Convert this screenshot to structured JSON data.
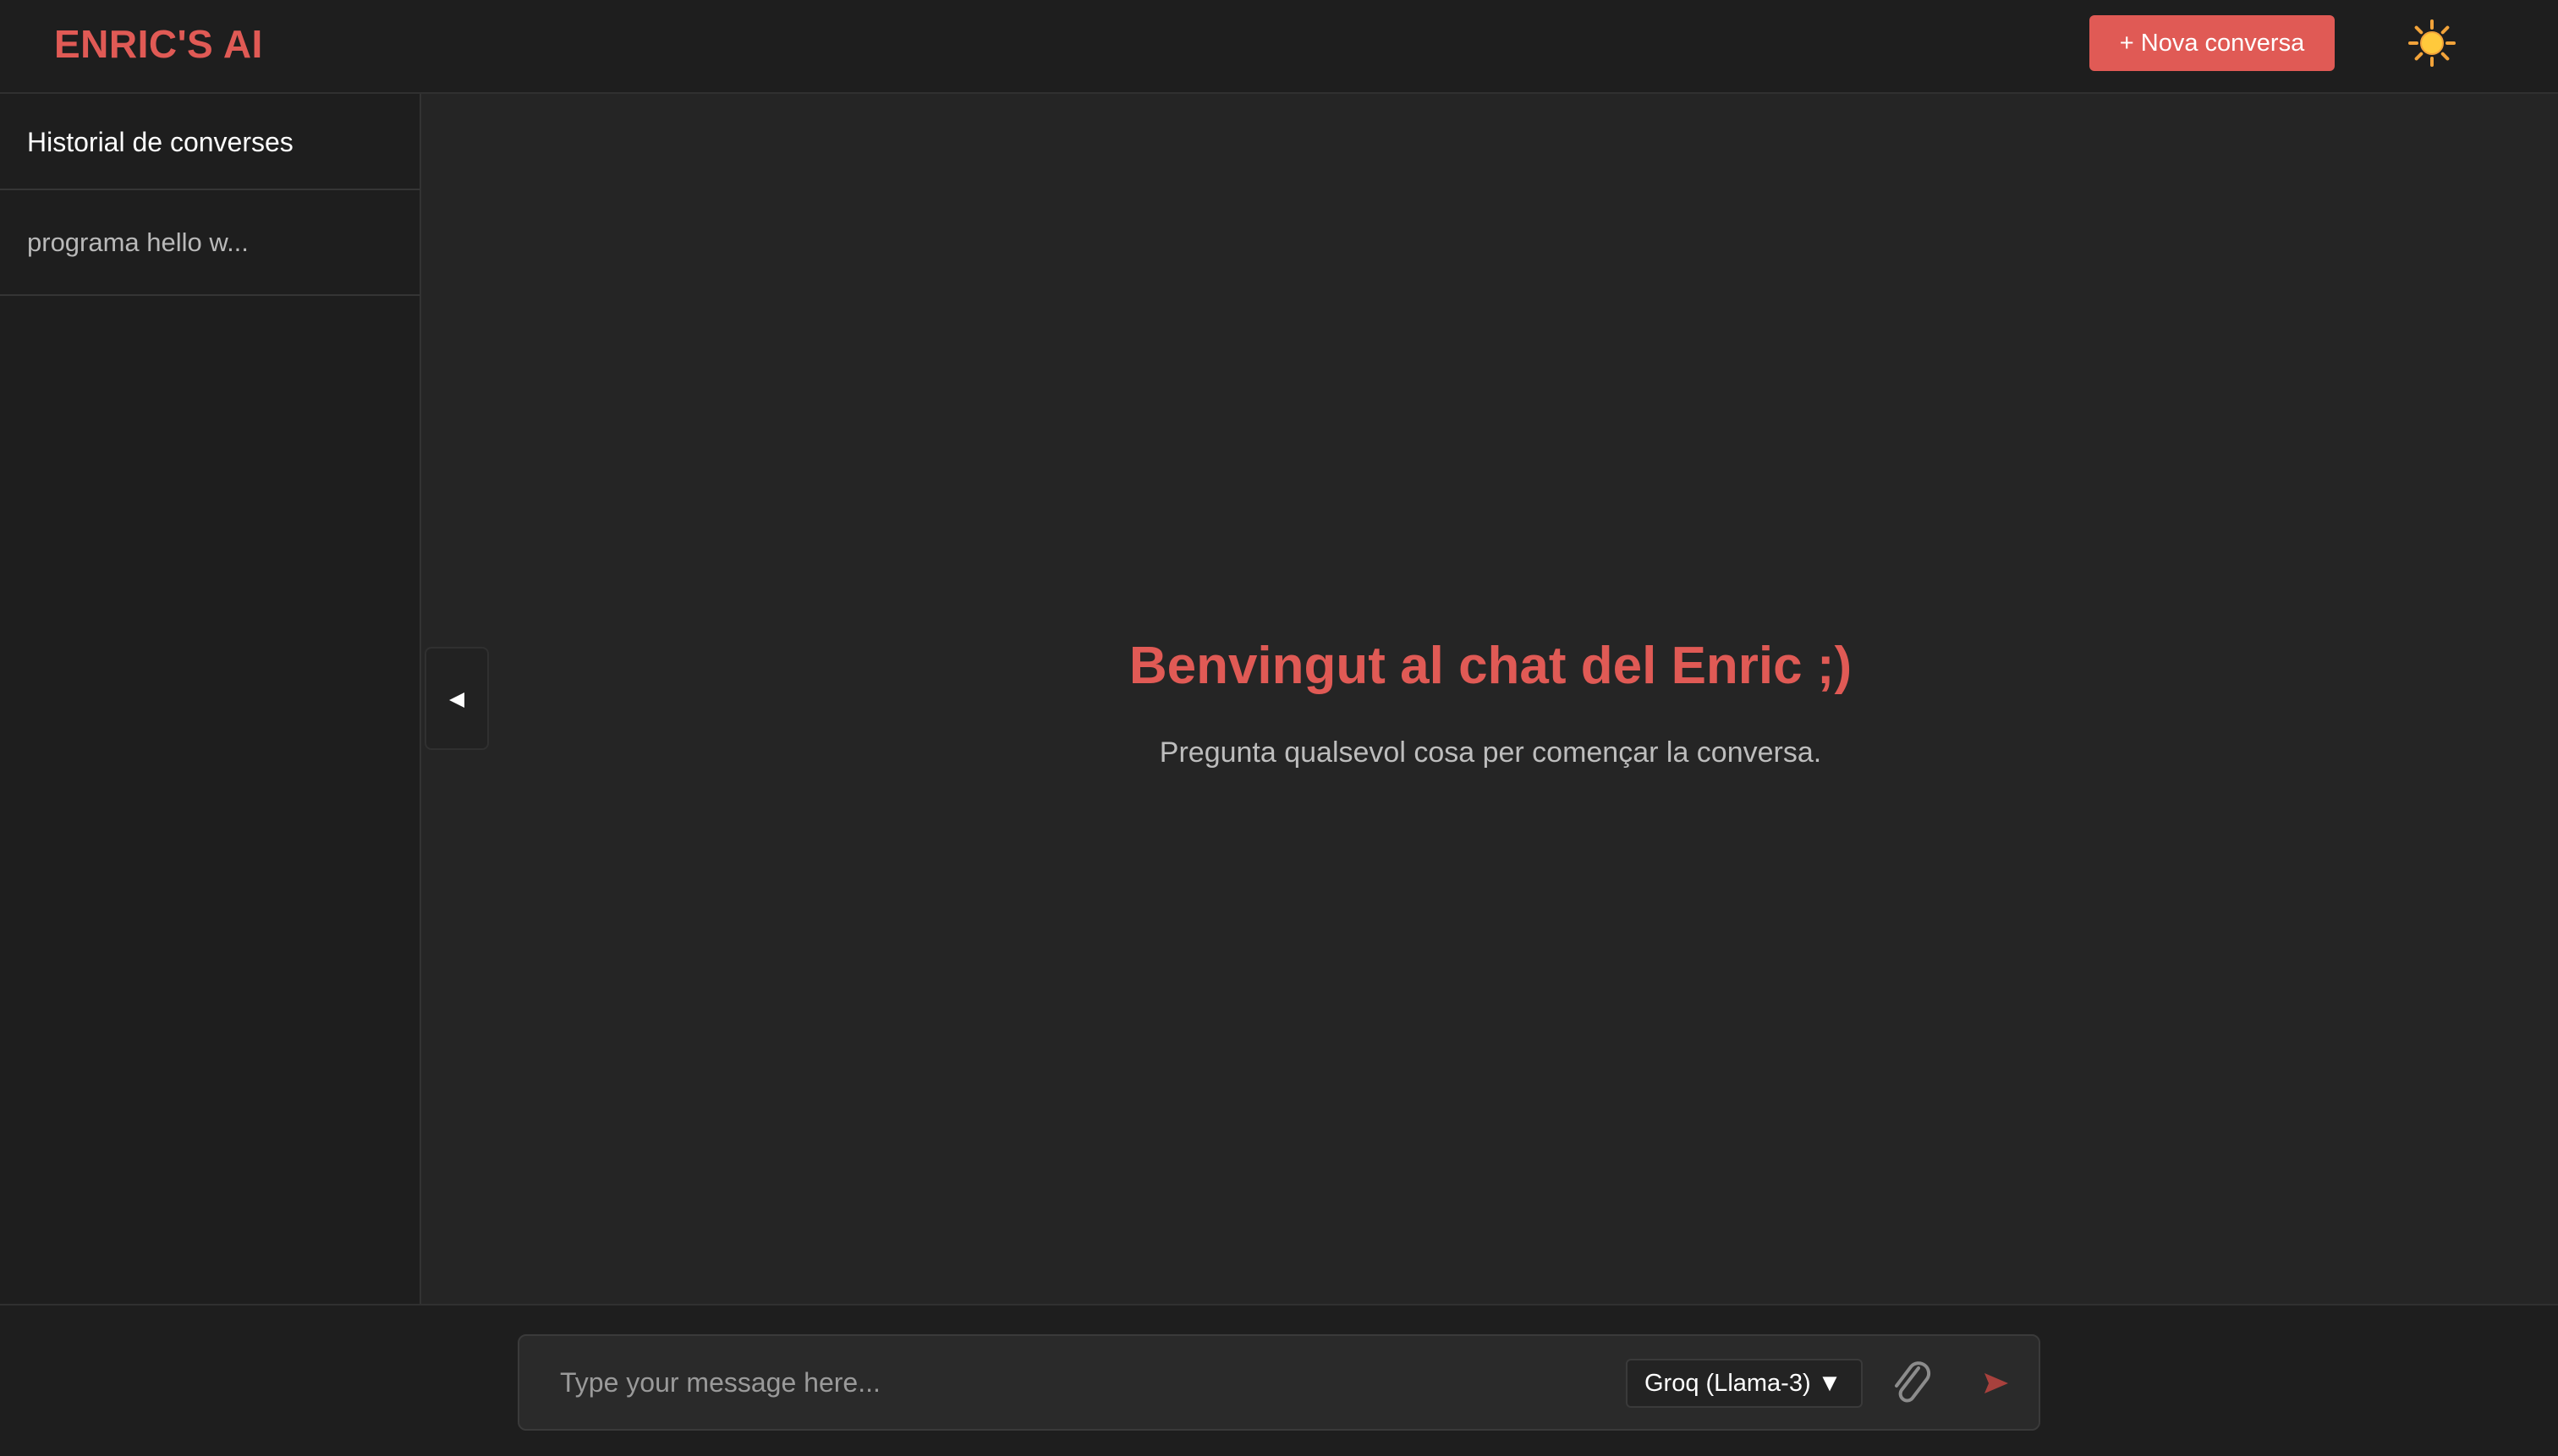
{
  "app": {
    "logo": "ENRIC'S AI",
    "brand_color": "#e05a55"
  },
  "header": {
    "new_chat_label": "+ Nova conversa",
    "theme_toggle_icon": "sun-icon"
  },
  "sidebar": {
    "title": "Historial de converses",
    "items": [
      {
        "label": "programa hello w..."
      }
    ],
    "collapse_icon": "triangle-left-icon"
  },
  "main": {
    "welcome_title": "Benvingut al chat del Enric ;)",
    "welcome_subtitle": "Pregunta qualsevol cosa per començar la conversa."
  },
  "composer": {
    "placeholder": "Type your message here...",
    "value": "",
    "model_selected": "Groq (Llama-3) ▼",
    "attach_icon": "paperclip-icon",
    "send_icon": "send-icon"
  }
}
